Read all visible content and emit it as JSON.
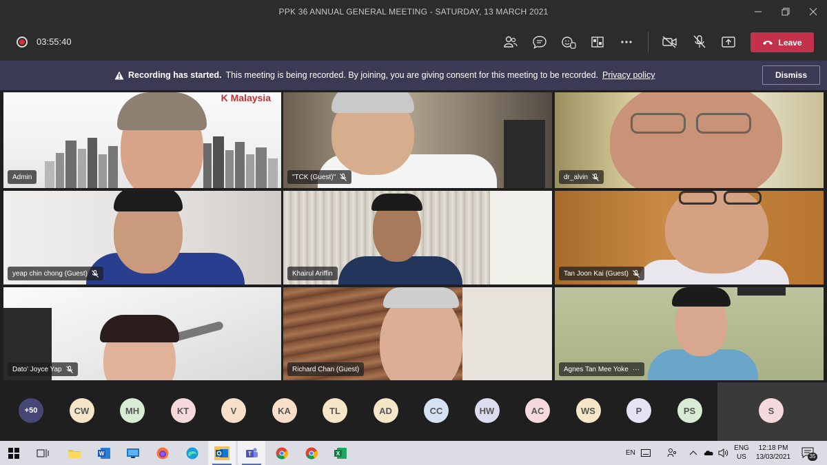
{
  "window": {
    "title": "PPK 36 ANNUAL GENERAL MEETING - SATURDAY, 13 MARCH 2021"
  },
  "toolbar": {
    "timer": "03:55:40",
    "leave_label": "Leave",
    "icons": [
      "participants-icon",
      "chat-icon",
      "reactions-icon",
      "rooms-icon",
      "more-icon",
      "camera-off-icon",
      "mic-off-icon",
      "share-icon"
    ]
  },
  "banner": {
    "title": "Recording has started.",
    "message": "This meeting is being recorded. By joining, you are giving consent for this meeting to be recorded.",
    "link": "Privacy policy",
    "dismiss_label": "Dismiss"
  },
  "participants": [
    {
      "name": "Admin",
      "muted": false
    },
    {
      "name": "\"TCK (Guest)\"",
      "muted": true
    },
    {
      "name": "dr_alvin",
      "muted": true
    },
    {
      "name": "yeap chin chong (Guest)",
      "muted": true
    },
    {
      "name": "Khairul Ariffin",
      "muted": false
    },
    {
      "name": "Tan Joon Kai (Guest)",
      "muted": true
    },
    {
      "name": "Dato' Joyce Yap",
      "muted": true
    },
    {
      "name": "Richard Chan (Guest)",
      "muted": false
    },
    {
      "name": "Agnes Tan Mee Yoke",
      "muted": false,
      "more": "···"
    }
  ],
  "tile_banner_text": "K Malaysia",
  "avatars": [
    {
      "initials": "+50",
      "color": "#464775"
    },
    {
      "initials": "CW",
      "color": "#f6e6c8"
    },
    {
      "initials": "MH",
      "color": "#d8ecd4"
    },
    {
      "initials": "KT",
      "color": "#f6d9dc"
    },
    {
      "initials": "V",
      "color": "#f7dfc9"
    },
    {
      "initials": "KA",
      "color": "#f7dfc9"
    },
    {
      "initials": "TL",
      "color": "#f6e6c8"
    },
    {
      "initials": "AD",
      "color": "#f6e6c8"
    },
    {
      "initials": "CC",
      "color": "#d4e3f3"
    },
    {
      "initials": "HW",
      "color": "#dcdcf0"
    },
    {
      "initials": "AC",
      "color": "#f6d9dc"
    },
    {
      "initials": "WS",
      "color": "#f6e6c8"
    },
    {
      "initials": "P",
      "color": "#e4e4f4"
    },
    {
      "initials": "PS",
      "color": "#d8ecd4"
    },
    {
      "initials": "S",
      "color": "#f6d9dc"
    }
  ],
  "taskbar": {
    "lang_short": "EN",
    "lang": "ENG",
    "region": "US",
    "time": "12:18 PM",
    "date": "13/03/2021",
    "notifications": "35"
  }
}
